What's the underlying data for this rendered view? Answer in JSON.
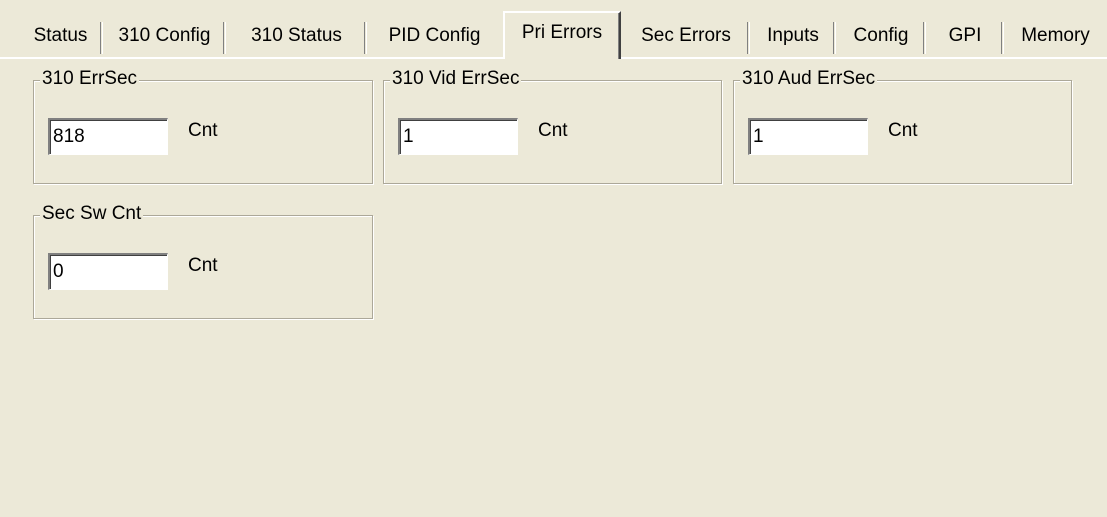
{
  "tabs": [
    {
      "label": "Status",
      "active": false
    },
    {
      "label": "310 Config",
      "active": false
    },
    {
      "label": "310 Status",
      "active": false
    },
    {
      "label": "PID Config",
      "active": false
    },
    {
      "label": "Pri Errors",
      "active": true
    },
    {
      "label": "Sec Errors",
      "active": false
    },
    {
      "label": "Inputs",
      "active": false
    },
    {
      "label": "Config",
      "active": false
    },
    {
      "label": "GPI",
      "active": false
    },
    {
      "label": "Memory",
      "active": false
    }
  ],
  "groups": {
    "errsec": {
      "title": "310 ErrSec",
      "value": "818",
      "unit": "Cnt"
    },
    "vid_errsec": {
      "title": "310 Vid ErrSec",
      "value": "1",
      "unit": "Cnt"
    },
    "aud_errsec": {
      "title": "310 Aud ErrSec",
      "value": "1",
      "unit": "Cnt"
    },
    "sec_sw_cnt": {
      "title": "Sec Sw Cnt",
      "value": "0",
      "unit": "Cnt"
    }
  }
}
